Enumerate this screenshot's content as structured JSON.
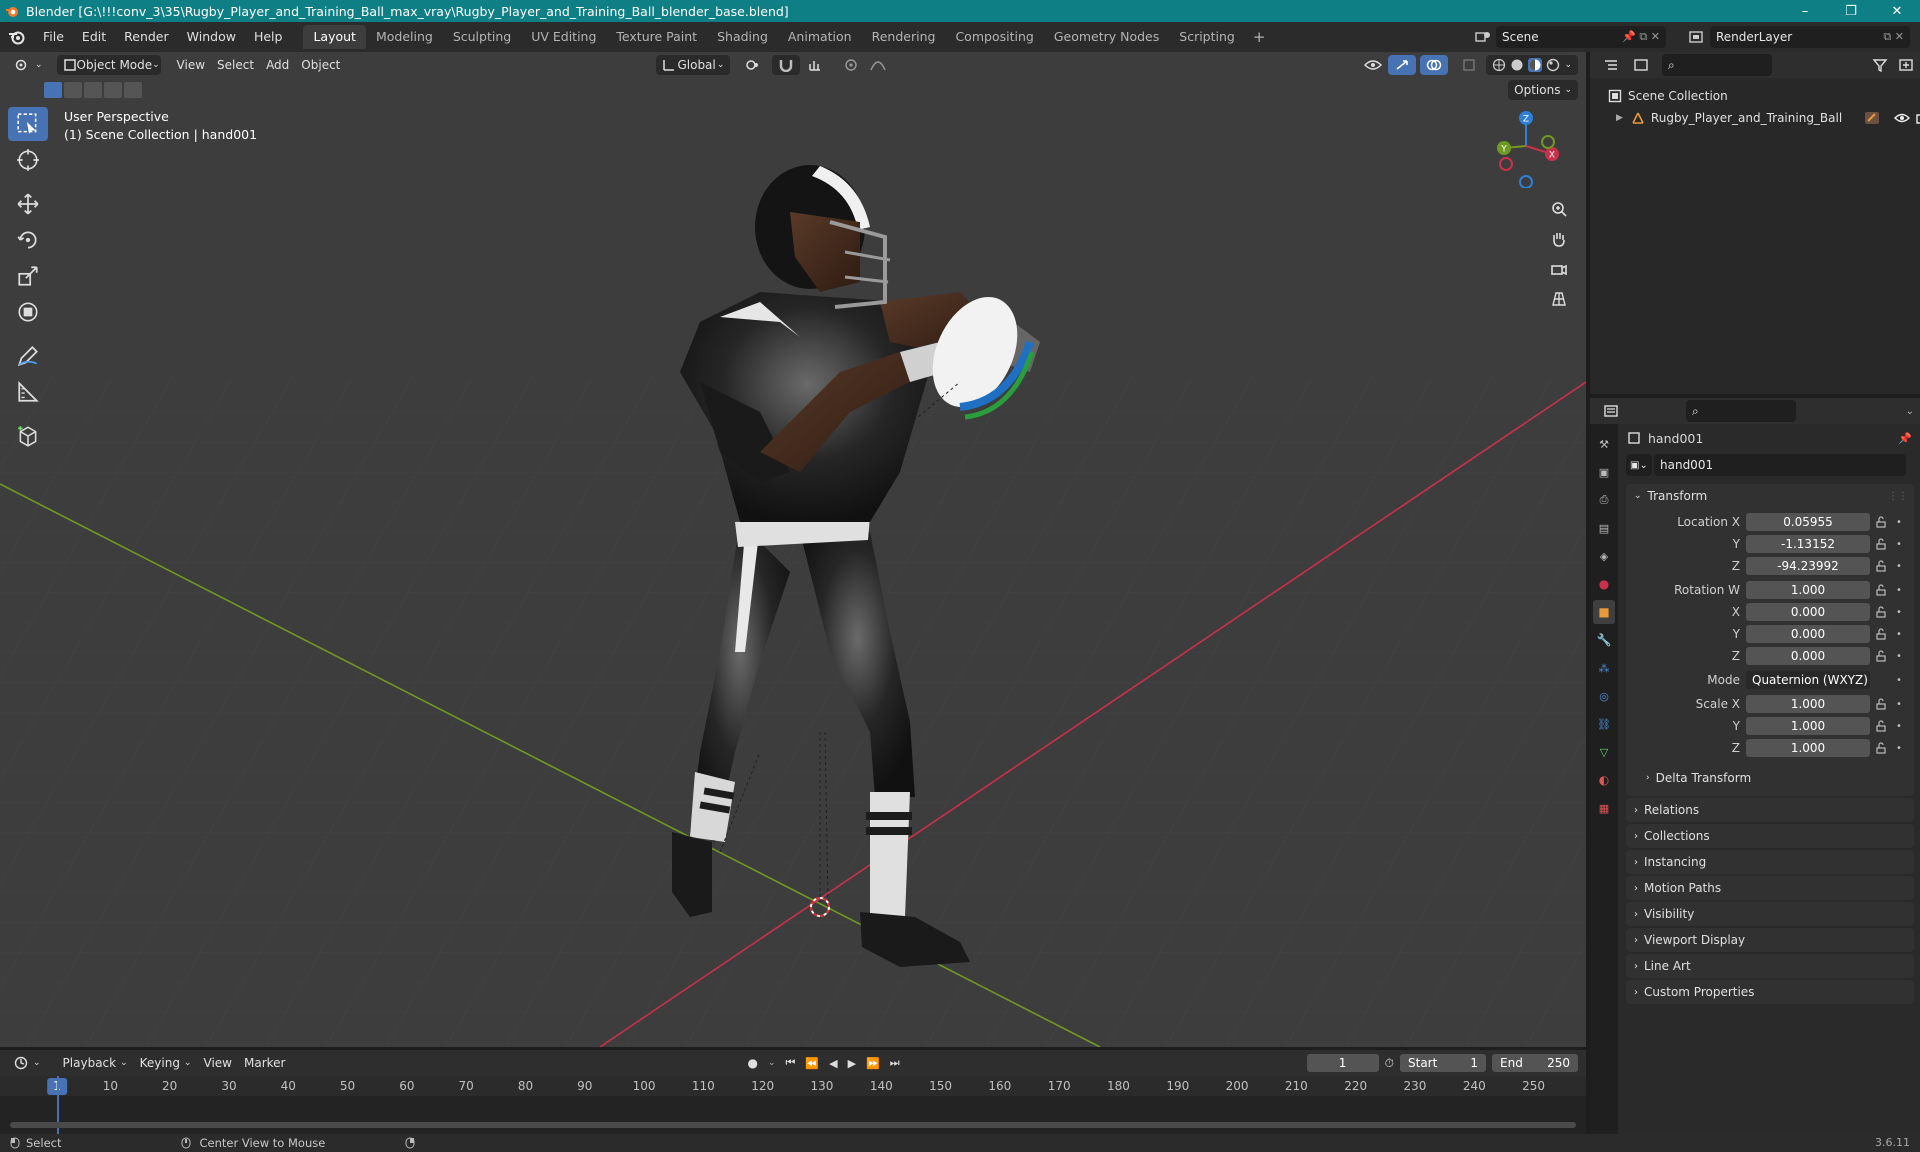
{
  "titlebar": {
    "title": "Blender [G:\\!!!conv_3\\35\\Rugby_Player_and_Training_Ball_max_vray\\Rugby_Player_and_Training_Ball_blender_base.blend]",
    "minimize": "–",
    "maximize": "❐",
    "close": "✕"
  },
  "menu": {
    "items": [
      "File",
      "Edit",
      "Render",
      "Window",
      "Help"
    ],
    "workspaces": [
      "Layout",
      "Modeling",
      "Sculpting",
      "UV Editing",
      "Texture Paint",
      "Shading",
      "Animation",
      "Rendering",
      "Compositing",
      "Geometry Nodes",
      "Scripting"
    ],
    "add_tab": "+",
    "scene": "Scene",
    "render_layer": "RenderLayer"
  },
  "viewport": {
    "mode": "Object Mode",
    "menus": [
      "View",
      "Select",
      "Add",
      "Object"
    ],
    "orientation": "Global",
    "options": "Options",
    "perspective": "User Perspective",
    "collection_info": "(1) Scene Collection | hand001",
    "gizmo": {
      "z": "Z",
      "y": "Y",
      "x": "X"
    }
  },
  "outliner": {
    "root": "Scene Collection",
    "object": "Rugby_Player_and_Training_Ball"
  },
  "properties": {
    "object_name": "hand001",
    "datablock_name": "hand001",
    "transform_label": "Transform",
    "location": {
      "label": "Location X",
      "x": "0.05955",
      "y": "-1.13152",
      "z": "-94.23992",
      "y_label": "Y",
      "z_label": "Z"
    },
    "rotation": {
      "label": "Rotation W",
      "w": "1.000",
      "x": "0.000",
      "y": "0.000",
      "z": "0.000",
      "x_label": "X",
      "y_label": "Y",
      "z_label": "Z"
    },
    "mode": {
      "label": "Mode",
      "value": "Quaternion (WXYZ)"
    },
    "scale": {
      "label": "Scale X",
      "x": "1.000",
      "y": "1.000",
      "z": "1.000",
      "y_label": "Y",
      "z_label": "Z"
    },
    "delta_transform": "Delta Transform",
    "panels": [
      "Relations",
      "Collections",
      "Instancing",
      "Motion Paths",
      "Visibility",
      "Viewport Display",
      "Line Art",
      "Custom Properties"
    ]
  },
  "timeline": {
    "menus": [
      "Playback",
      "Keying",
      "View",
      "Marker"
    ],
    "current_frame": "1",
    "start_label": "Start",
    "start": "1",
    "end_label": "End",
    "end": "250",
    "ruler": [
      "10",
      "20",
      "30",
      "40",
      "50",
      "60",
      "70",
      "80",
      "90",
      "100",
      "110",
      "120",
      "130",
      "140",
      "150",
      "160",
      "170",
      "180",
      "190",
      "200",
      "210",
      "220",
      "230",
      "240",
      "250"
    ],
    "playhead": "1"
  },
  "statusbar": {
    "select": "Select",
    "center_view": "Center View to Mouse",
    "version": "3.6.11"
  },
  "colors": {
    "accent": "#4772b3",
    "titlebar": "#0f7f86",
    "x_axis": "#c9314a",
    "y_axis": "#6f9a22",
    "z_axis": "#2f7fd8"
  }
}
